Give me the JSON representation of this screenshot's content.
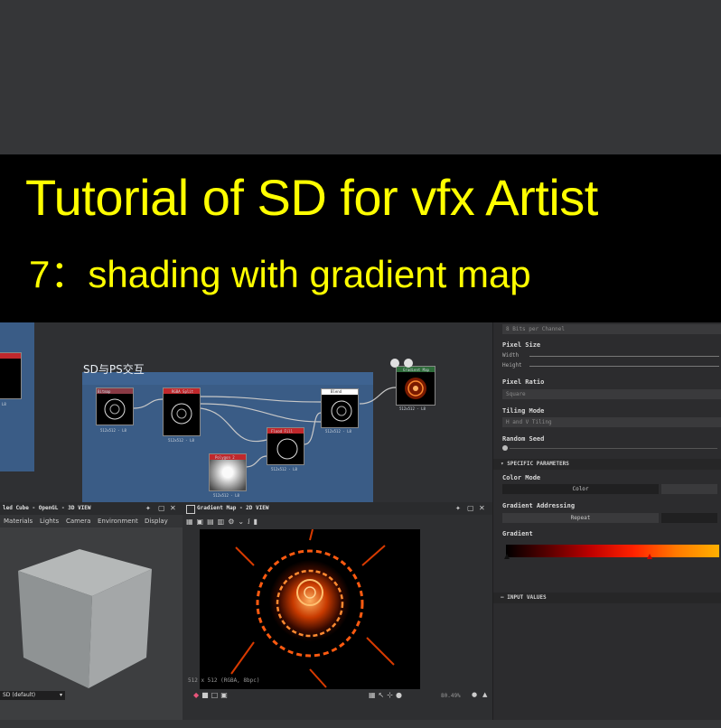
{
  "title": {
    "line1": "Tutorial of  SD for vfx Artist",
    "line2": "7：shading with gradient map"
  },
  "graph": {
    "frame_title": "SD与PS交互",
    "nodes": [
      {
        "header": "Bitmap",
        "footer": "512x512 - L8"
      },
      {
        "header": "RGBA Split",
        "footer": "512x512 - L8"
      },
      {
        "header": "Blend",
        "footer": "512x512 - L8"
      },
      {
        "header": "Gradient Map",
        "footer": "512x512 - L8"
      },
      {
        "header": "Flood Fill",
        "footer": "512x512 - L8"
      },
      {
        "header": "Polygon 2",
        "footer": "512x512 - L8"
      },
      {
        "header": "",
        "footer": "512x512 - L8"
      }
    ]
  },
  "panel": {
    "bits_label": "8 Bits per Channel",
    "pixel_size_label": "Pixel Size",
    "width_label": "Width",
    "height_label": "Height",
    "pixel_ratio_label": "Pixel Ratio",
    "pixel_ratio_value": "Square",
    "tiling_mode_label": "Tiling Mode",
    "tiling_mode_value": "H and V Tiling",
    "random_seed_label": "Random Seed",
    "specific_parameters": "SPECIFIC PARAMETERS",
    "color_mode_label": "Color Mode",
    "color_mode_value": "Color",
    "gradient_addressing_label": "Gradient Addressing",
    "gradient_addressing_value": "Repeat",
    "gradient_label": "Gradient",
    "input_values": "INPUT VALUES",
    "gradient_colors": [
      "#000000",
      "#5a0000",
      "#c00000",
      "#ff2200",
      "#ff7a00",
      "#ffb000"
    ]
  },
  "view3d": {
    "title": "led Cube - OpenGL - 3D VIEW",
    "menu": [
      "Materials",
      "Lights",
      "Camera",
      "Environment",
      "Display"
    ],
    "dropdown": "SD (default)"
  },
  "view2d": {
    "title": "Gradient Map - 2D VIEW",
    "info": "512 x 512 (RGBA, 8bpc)",
    "zoom": "80.49%"
  },
  "colors": {
    "title_text": "#ffff00",
    "frame_blue": "#3a5c86",
    "node_red_header": "#c0282c",
    "node_green_header": "#2e6b3a"
  }
}
